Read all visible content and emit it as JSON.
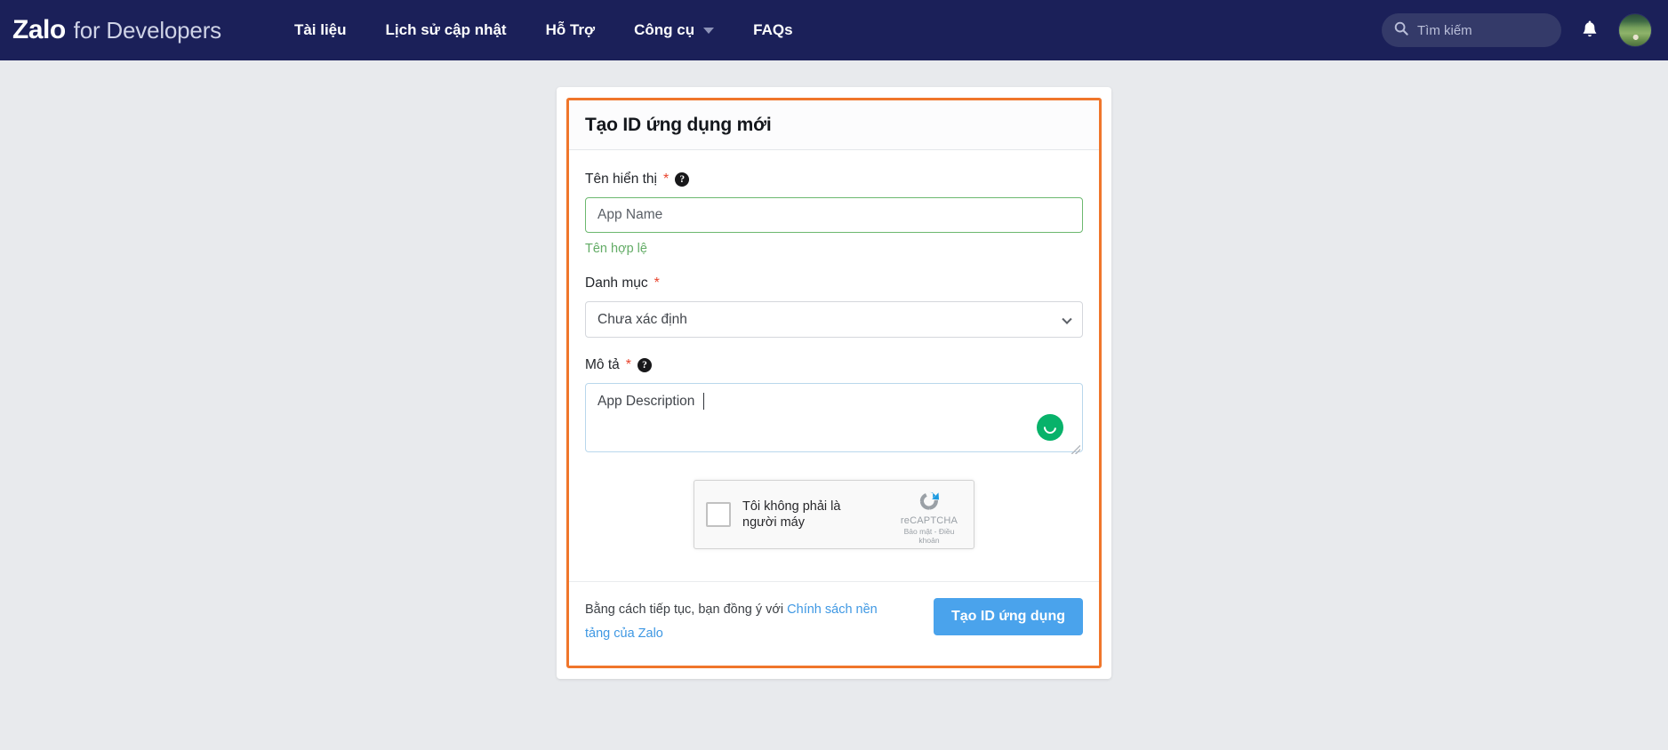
{
  "nav": {
    "brand_primary": "Zalo",
    "brand_secondary": "for Developers",
    "links": [
      {
        "label": "Tài liệu",
        "has_dropdown": false
      },
      {
        "label": "Lịch sử cập nhật",
        "has_dropdown": false
      },
      {
        "label": "Hỗ Trợ",
        "has_dropdown": false
      },
      {
        "label": "Công cụ",
        "has_dropdown": true
      },
      {
        "label": "FAQs",
        "has_dropdown": false
      }
    ],
    "search_placeholder": "Tìm kiếm",
    "search_value": "",
    "search_icon": "search-icon",
    "notification_icon": "bell-icon",
    "avatar_icon": "user-avatar",
    "bg_color": "#1b2059"
  },
  "card": {
    "title": "Tạo ID ứng dụng mới",
    "border_color": "#f0762b",
    "fields": {
      "display_name": {
        "label": "Tên hiển thị",
        "required_mark": "*",
        "help_icon": "help-circle-icon",
        "value": "App Name",
        "placeholder": "App Name",
        "helper_text": "Tên hợp lệ",
        "helper_color": "#63ac66",
        "border_color": "#6cb86f"
      },
      "category": {
        "label": "Danh mục",
        "required_mark": "*",
        "selected": "Chưa xác định",
        "options": [
          "Chưa xác định"
        ],
        "chevron_icon": "chevron-down-icon"
      },
      "description": {
        "label": "Mô tả",
        "required_mark": "*",
        "help_icon": "help-circle-icon",
        "value": "App Description",
        "placeholder": "App Description",
        "spinner_icon": "loading-spinner-icon",
        "spinner_color": "#08b26a",
        "border_color": "#b9d7ec"
      }
    },
    "recaptcha": {
      "checkbox_label": "Tôi không phải là người máy",
      "brand": "reCAPTCHA",
      "terms": "Bảo mật - Điều khoản",
      "logo_icon": "recaptcha-logo-icon"
    },
    "footer": {
      "terms_prefix": "Bằng cách tiếp tục, bạn đồng ý với ",
      "terms_link": "Chính sách nền tảng của Zalo",
      "submit_label": "Tạo ID ứng dụng",
      "submit_color": "#4aa3ec"
    }
  }
}
